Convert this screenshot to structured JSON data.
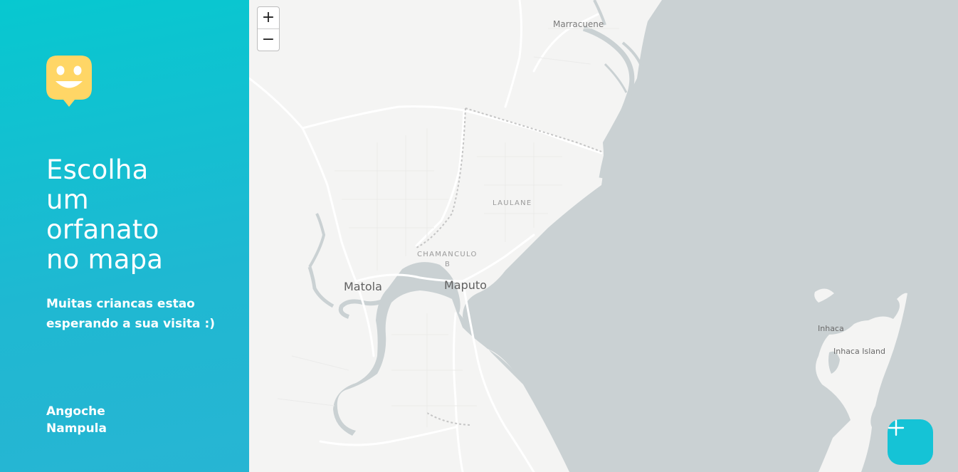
{
  "sidebar": {
    "headline": [
      "Escolha",
      "um",
      "orfanato",
      "no mapa"
    ],
    "subtitle": "Muitas criancas estao esperando a sua visita :)",
    "location": {
      "city": "Angoche",
      "state": "Nampula"
    }
  },
  "map": {
    "zoom_in": "+",
    "zoom_out": "−",
    "labels": {
      "marracuene": "Marracuene",
      "laulane": "LAULANE",
      "chamanculo_1": "CHAMANCULO",
      "chamanculo_2": "B",
      "matola": "Matola",
      "maputo": "Maputo",
      "inhaca": "Inhaca",
      "inhaca_island": "Inhaca Island"
    },
    "colors": {
      "land": "#f4f4f3",
      "water": "#cad1d3",
      "roads": "#ffffff"
    }
  },
  "fab": {
    "icon": "plus-icon",
    "color": "#15c3d6"
  },
  "colors": {
    "accent": "#15c3d6",
    "logo": "#ffd666"
  }
}
